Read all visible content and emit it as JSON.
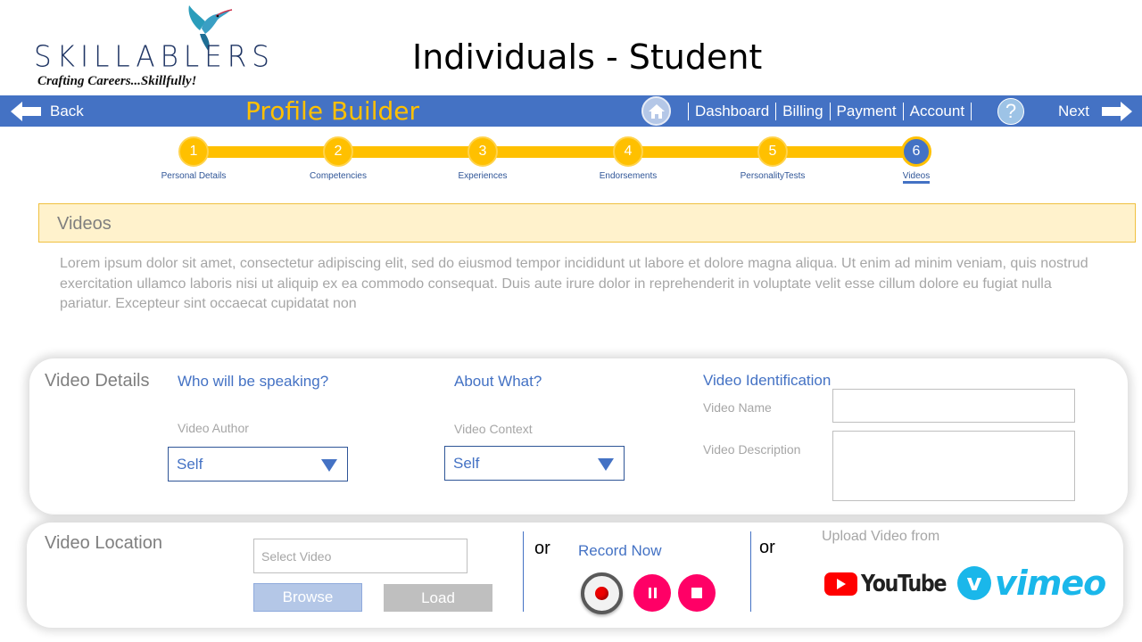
{
  "header": {
    "logo_text": "SKILLABLERS",
    "logo_tagline": "Crafting Careers...Skillfully!",
    "page_title": "Individuals - Student"
  },
  "navbar": {
    "back_label": "Back",
    "section_title": "Profile Builder",
    "links": [
      "Dashboard",
      "Billing",
      "Payment",
      "Account"
    ],
    "help_label": "?",
    "next_label": "Next"
  },
  "stepper": {
    "steps": [
      {
        "number": "1",
        "label": "Personal Details"
      },
      {
        "number": "2",
        "label": "Competencies"
      },
      {
        "number": "3",
        "label": "Experiences"
      },
      {
        "number": "4",
        "label": "Endorsements"
      },
      {
        "number": "5",
        "label": "PersonalityTests"
      },
      {
        "number": "6",
        "label": "Videos"
      }
    ],
    "active_step": 6
  },
  "section": {
    "title": "Videos",
    "description": "Lorem ipsum dolor sit amet, consectetur adipiscing elit, sed do eiusmod tempor incididunt ut labore et dolore magna aliqua. Ut enim ad minim veniam, quis nostrud exercitation ullamco laboris nisi ut aliquip ex ea commodo consequat. Duis aute irure dolor in reprehenderit in voluptate velit esse cillum dolore eu fugiat nulla pariatur. Excepteur sint occaecat cupidatat non"
  },
  "video_details": {
    "title": "Video Details",
    "speaker_question": "Who will be speaking?",
    "author_label": "Video Author",
    "author_value": "Self",
    "about_question": "About What?",
    "context_label": "Video Context",
    "context_value": "Self",
    "identification_title": "Video Identification",
    "name_label": "Video Name",
    "name_value": "",
    "description_label": "Video Description",
    "description_value": ""
  },
  "video_location": {
    "title": "Video Location",
    "select_placeholder": "Select Video",
    "browse_label": "Browse",
    "load_label": "Load",
    "or_label": "or",
    "record_label": "Record Now",
    "upload_label": "Upload Video from",
    "youtube_label": "YouTube",
    "vimeo_label": "vimeo"
  },
  "colors": {
    "nav_blue": "#4472c4",
    "accent_yellow": "#ffc000",
    "record_pink": "#ff0066"
  }
}
